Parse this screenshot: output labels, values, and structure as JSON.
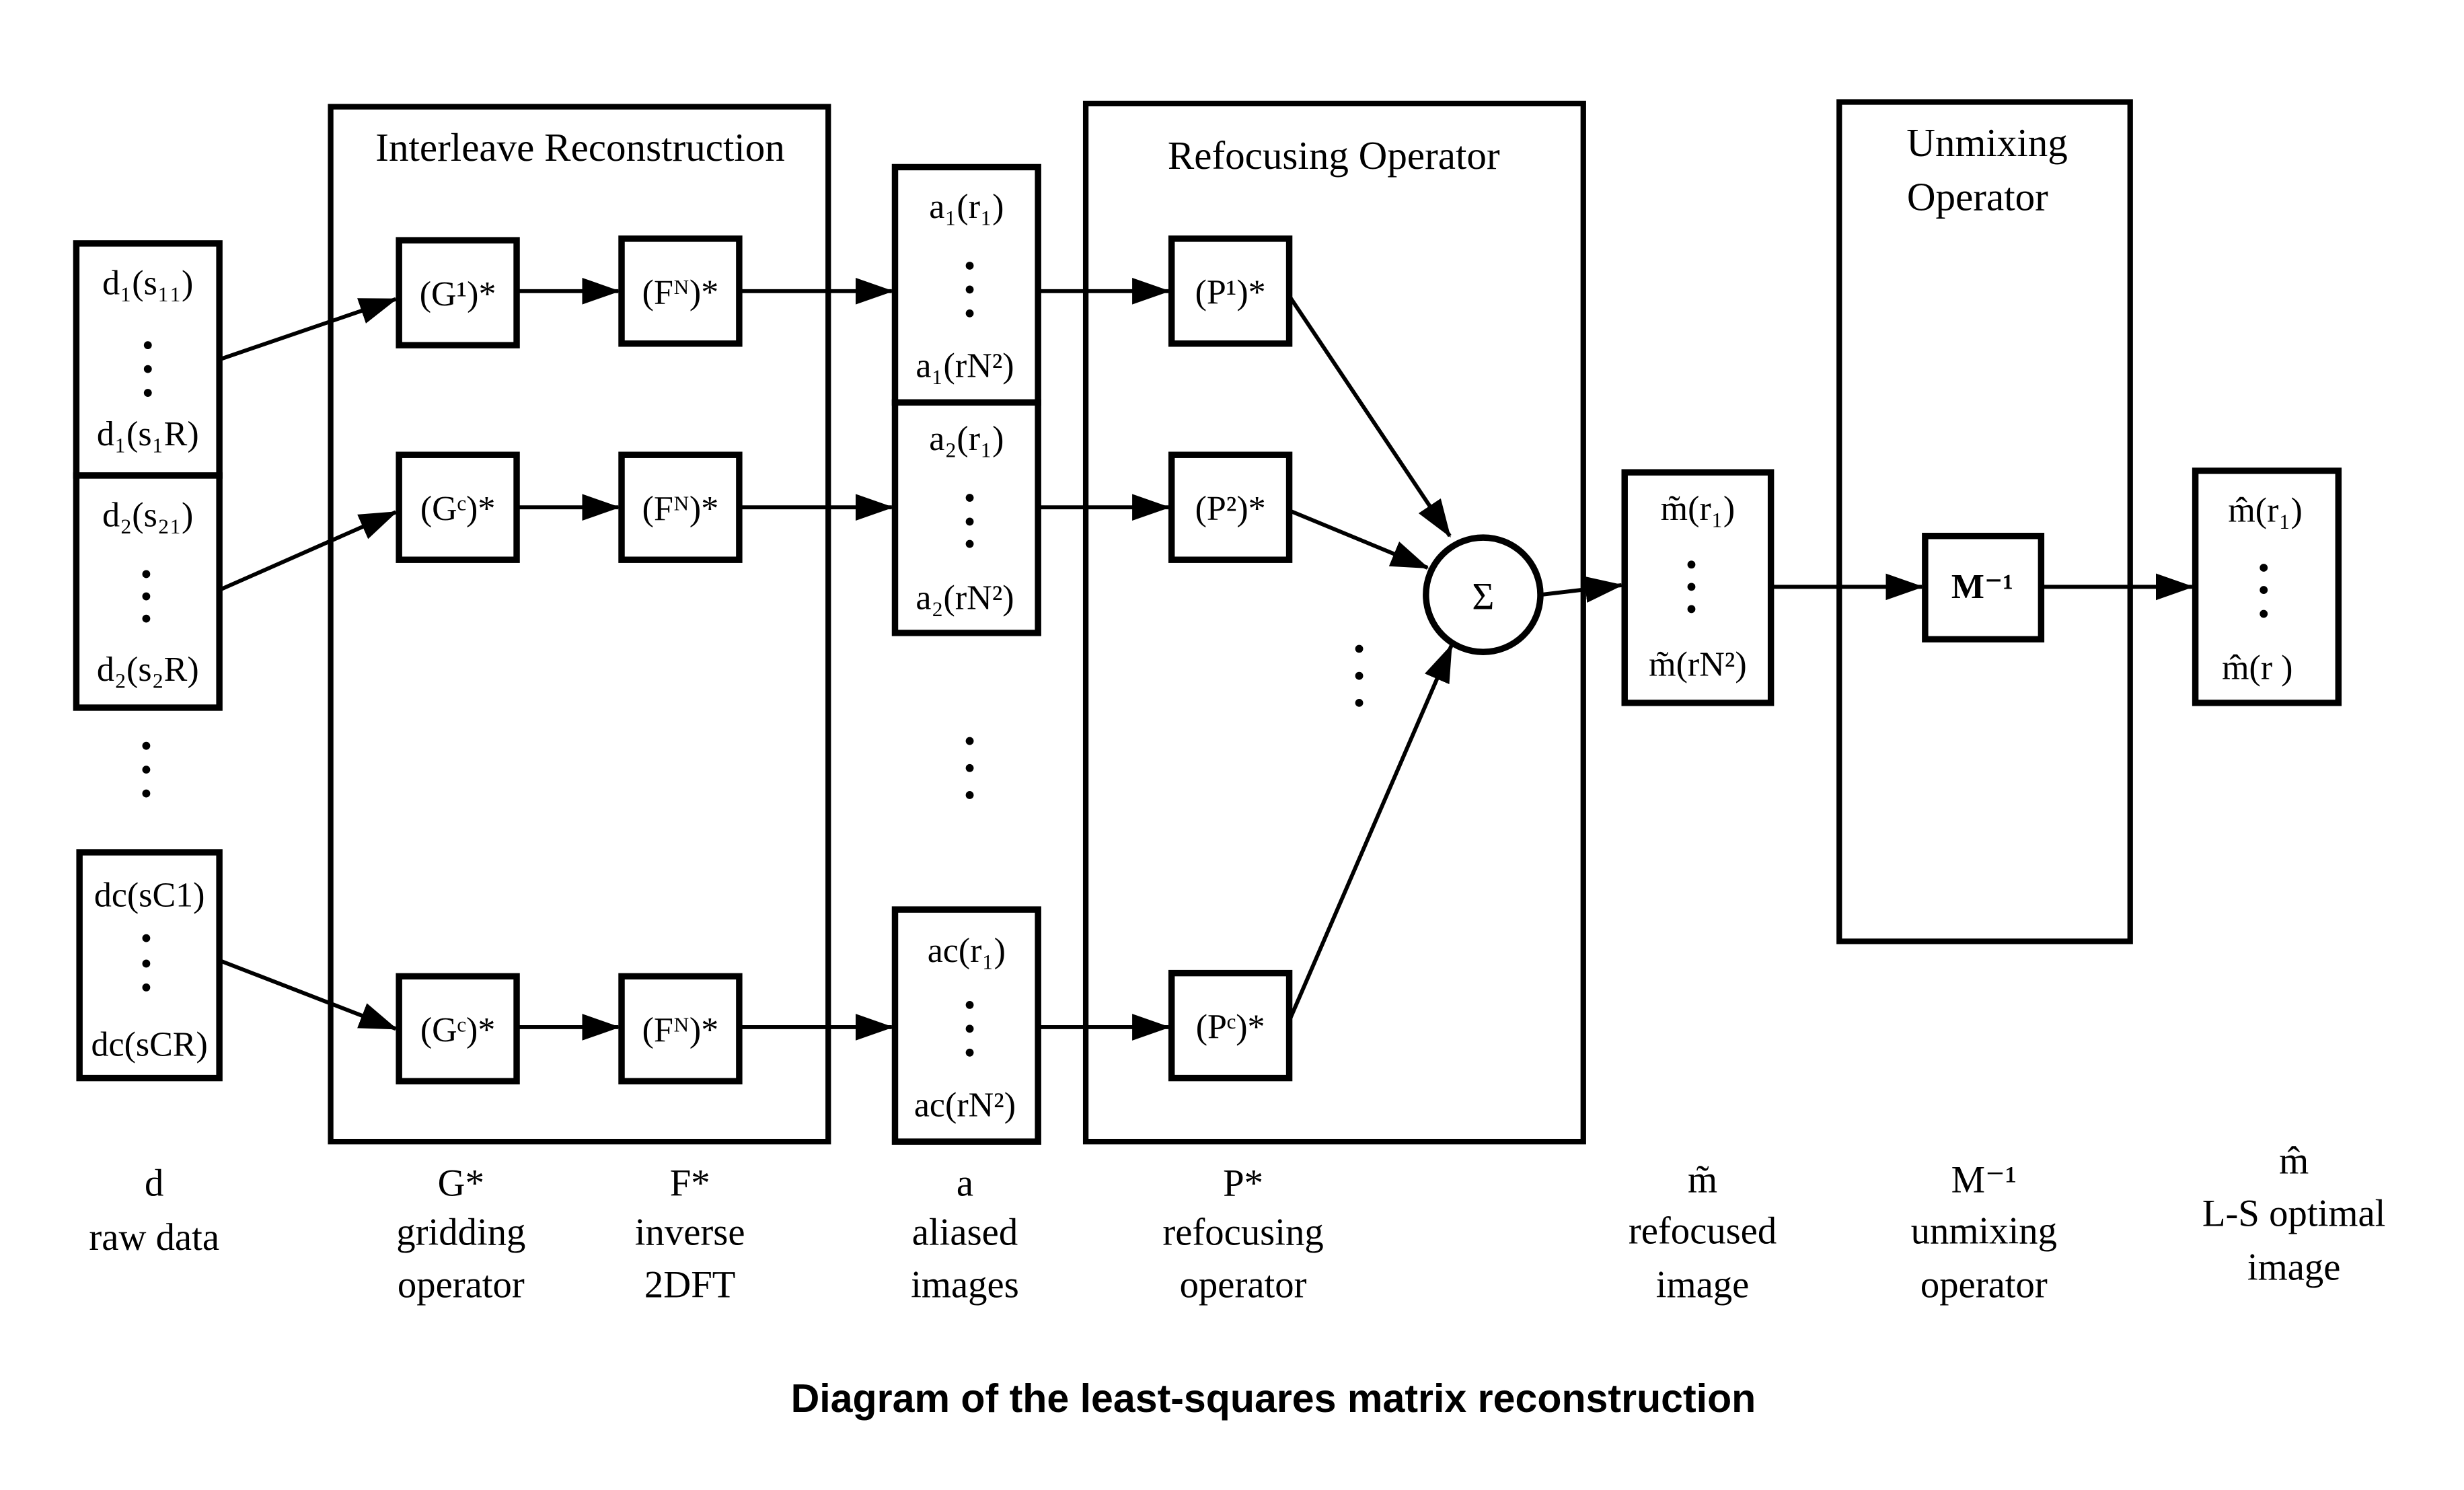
{
  "caption": "Diagram of the least-squares matrix reconstruction",
  "groups": {
    "interleave": "Interleave Reconstruction",
    "refocusing": "Refocusing Operator",
    "unmixing_line1": "Unmixing",
    "unmixing_line2": "Operator"
  },
  "raw_data": [
    {
      "top": "d₁(s₁₁)",
      "bottom": "d₁(s₁R)"
    },
    {
      "top": "d₂(s₂₁)",
      "bottom": "d₂(s₂R)"
    },
    {
      "top": "dc(sC1)",
      "bottom": "dc(sCR)"
    }
  ],
  "gridding_ops": [
    "(G¹)*",
    "(Gᶜ)*",
    "(Gᶜ)*"
  ],
  "fourier_ops": [
    "(Fᴺ)*",
    "(Fᴺ)*",
    "(Fᴺ)*"
  ],
  "aliased": [
    {
      "top": "a₁(r₁)",
      "bottom": "a₁(rN²)"
    },
    {
      "top": "a₂(r₁)",
      "bottom": "a₂(rN²)"
    },
    {
      "top": "ac(r₁)",
      "bottom": "ac(rN²)"
    }
  ],
  "refocus_ops": [
    "(P¹)*",
    "(P²)*",
    "(Pᶜ)*"
  ],
  "sum_symbol": "Σ",
  "refocused": {
    "top": "m̃(r₁)",
    "bottom": "m̃(rN²)"
  },
  "unmix_op": "M⁻¹",
  "optimal": {
    "top": "m̂(r₁)",
    "bottom": "m̂(r  )"
  },
  "ellipsis": "⋮",
  "bottom_labels": [
    {
      "symbol": "d",
      "line1": "raw data",
      "line2": ""
    },
    {
      "symbol": "G*",
      "line1": "gridding",
      "line2": "operator"
    },
    {
      "symbol": "F*",
      "line1": "inverse",
      "line2": "2DFT"
    },
    {
      "symbol": "a",
      "line1": "aliased",
      "line2": "images"
    },
    {
      "symbol": "P*",
      "line1": "refocusing",
      "line2": "operator"
    },
    {
      "symbol": "m̃",
      "line1": "refocused",
      "line2": "image"
    },
    {
      "symbol": "M⁻¹",
      "line1": "unmixing",
      "line2": "operator"
    },
    {
      "symbol": "m̂",
      "line1": "L-S optimal",
      "line2": "image"
    }
  ]
}
